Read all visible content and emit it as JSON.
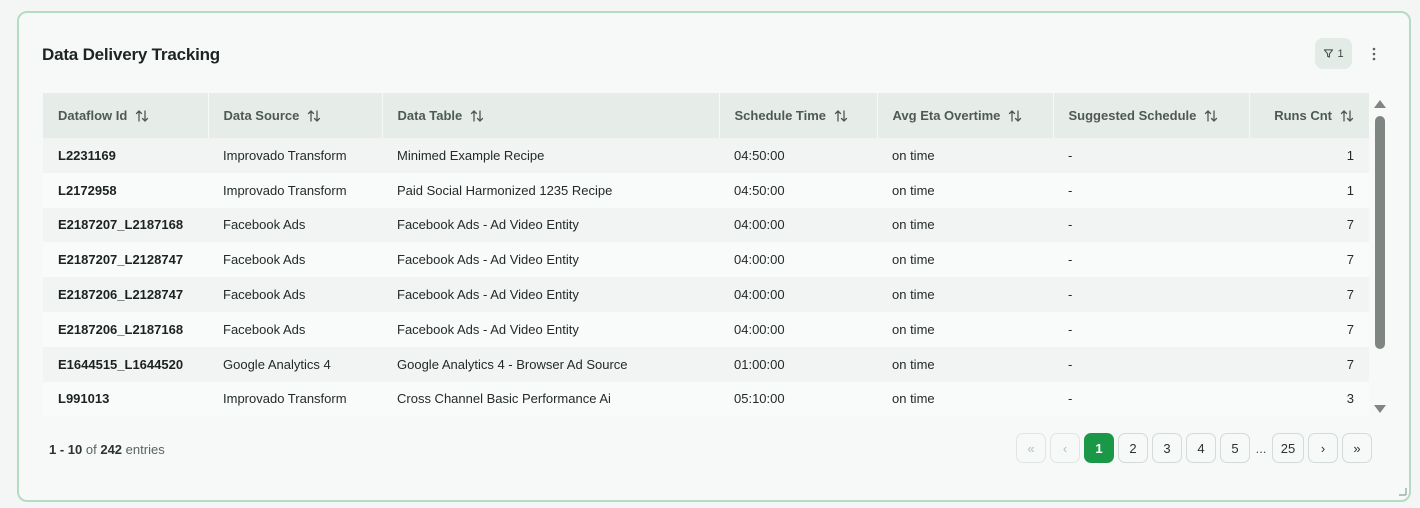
{
  "card": {
    "title": "Data Delivery Tracking",
    "filter_count": "1"
  },
  "table": {
    "columns": [
      "Dataflow Id",
      "Data Source",
      "Data Table",
      "Schedule Time",
      "Avg Eta Overtime",
      "Suggested Schedule",
      "Runs Cnt"
    ],
    "rows": [
      [
        "L2231169",
        "Improvado Transform",
        "Minimed Example Recipe",
        "04:50:00",
        "on time",
        "-",
        "1"
      ],
      [
        "L2172958",
        "Improvado Transform",
        "Paid Social Harmonized 1235 Recipe",
        "04:50:00",
        "on time",
        "-",
        "1"
      ],
      [
        "E2187207_L2187168",
        "Facebook Ads",
        "Facebook Ads - Ad Video Entity",
        "04:00:00",
        "on time",
        "-",
        "7"
      ],
      [
        "E2187207_L2128747",
        "Facebook Ads",
        "Facebook Ads - Ad Video Entity",
        "04:00:00",
        "on time",
        "-",
        "7"
      ],
      [
        "E2187206_L2128747",
        "Facebook Ads",
        "Facebook Ads - Ad Video Entity",
        "04:00:00",
        "on time",
        "-",
        "7"
      ],
      [
        "E2187206_L2187168",
        "Facebook Ads",
        "Facebook Ads - Ad Video Entity",
        "04:00:00",
        "on time",
        "-",
        "7"
      ],
      [
        "E1644515_L1644520",
        "Google Analytics 4",
        "Google Analytics 4 - Browser Ad Source",
        "01:00:00",
        "on time",
        "-",
        "7"
      ],
      [
        "L991013",
        "Improvado Transform",
        "Cross Channel Basic Performance Ai",
        "05:10:00",
        "on time",
        "-",
        "3"
      ]
    ]
  },
  "footer": {
    "range": "1 - 10",
    "of_text": "of",
    "total": "242",
    "entries_text": "entries"
  },
  "pagination": {
    "first": "«",
    "prev": "‹",
    "pages": [
      "1",
      "2",
      "3",
      "4",
      "5"
    ],
    "ellipsis": "...",
    "last_page": "25",
    "next": "›",
    "last": "»",
    "current_page": "1"
  },
  "colors": {
    "accent": "#1a9848",
    "card_border": "#b5dcc1",
    "header_bg": "#e6ece8"
  },
  "icons": {
    "filter": "filter-icon",
    "more": "more-vertical-icon",
    "sort": "sort-arrows-icon"
  }
}
